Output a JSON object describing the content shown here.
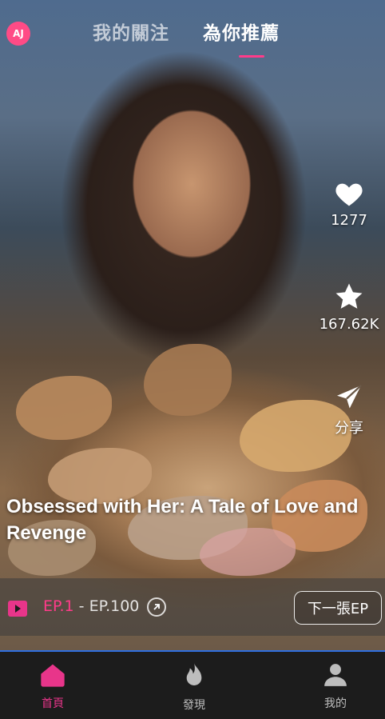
{
  "header": {
    "logo_text": "AJ",
    "tabs": [
      {
        "label": "我的關注",
        "active": false
      },
      {
        "label": "為你推薦",
        "active": true
      }
    ]
  },
  "actions": {
    "likes": "1277",
    "favorites": "167.62K",
    "share_label": "分享"
  },
  "video": {
    "title": "Obsessed with Her: A Tale of Love and Revenge"
  },
  "episodes": {
    "current": "EP.1",
    "separator": " - ",
    "last": "EP.100",
    "next_label": "下一張EP"
  },
  "bottom_nav": {
    "items": [
      {
        "label": "首頁",
        "icon": "home-icon",
        "active": true
      },
      {
        "label": "發現",
        "icon": "flame-icon",
        "active": false
      },
      {
        "label": "我的",
        "icon": "user-icon",
        "active": false
      }
    ]
  },
  "colors": {
    "accent": "#e8358a",
    "tab_indicator": "#ff3b8a",
    "nav_bg": "#1c1c1c"
  }
}
